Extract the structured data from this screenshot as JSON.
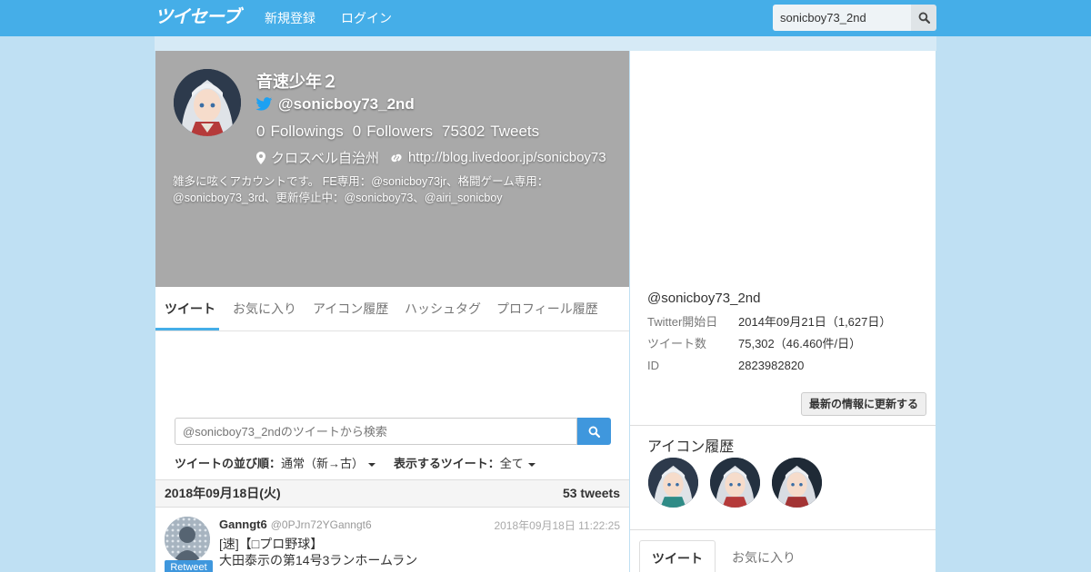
{
  "nav": {
    "logo": "ツイセーブ",
    "signup": "新規登録",
    "login": "ログイン",
    "search_value": "sonicboy73_2nd"
  },
  "profile": {
    "name": "音速少年２",
    "handle": "@sonicboy73_2nd",
    "followings_count": "0",
    "followings_label": "Followings",
    "followers_count": "0",
    "followers_label": "Followers",
    "tweets_count": "75302",
    "tweets_label": "Tweets",
    "location": "クロスベル自治州",
    "url": "http://blog.livedoor.jp/sonicboy73",
    "bio": "雑多に呟くアカウントです。 FE専用：@sonicboy73jr、格闘ゲーム専用：@sonicboy73_3rd、更新停止中：@sonicboy73、@airi_sonicboy"
  },
  "tabs": [
    "ツイート",
    "お気に入り",
    "アイコン履歴",
    "ハッシュタグ",
    "プロフィール履歴"
  ],
  "tweet_search": {
    "placeholder": "@sonicboy73_2ndのツイートから検索"
  },
  "sort": {
    "order_label": "ツイートの並び順：",
    "order_value": "通常（新→古）",
    "show_label": "表示するツイート：",
    "show_value": "全て"
  },
  "date_group": {
    "date": "2018年09月18日(火)",
    "count": "53 tweets"
  },
  "tweet": {
    "user": "Ganngt6",
    "screen_name": "@0PJrn72YGanngt6",
    "time": "2018年09月18日 11:22:25",
    "badge": "Retweet",
    "line1": "[速]【□プロ野球】",
    "line2": "大田泰示の第14号3ランホームラン"
  },
  "sidebar": {
    "account": "@sonicboy73_2nd",
    "rows": [
      {
        "k": "Twitter開始日",
        "v": "2014年09月21日（1,627日）"
      },
      {
        "k": "ツイート数",
        "v": "75,302（46.460件/日）"
      },
      {
        "k": "ID",
        "v": "2823982820"
      }
    ],
    "refresh": "最新の情報に更新する",
    "icon_history_title": "アイコン履歴",
    "tabs": [
      "ツイート",
      "お気に入り"
    ]
  },
  "colors": {
    "brand": "#45aee8",
    "header_bg": "#a9a9a9",
    "button_blue": "#3f97dd"
  }
}
